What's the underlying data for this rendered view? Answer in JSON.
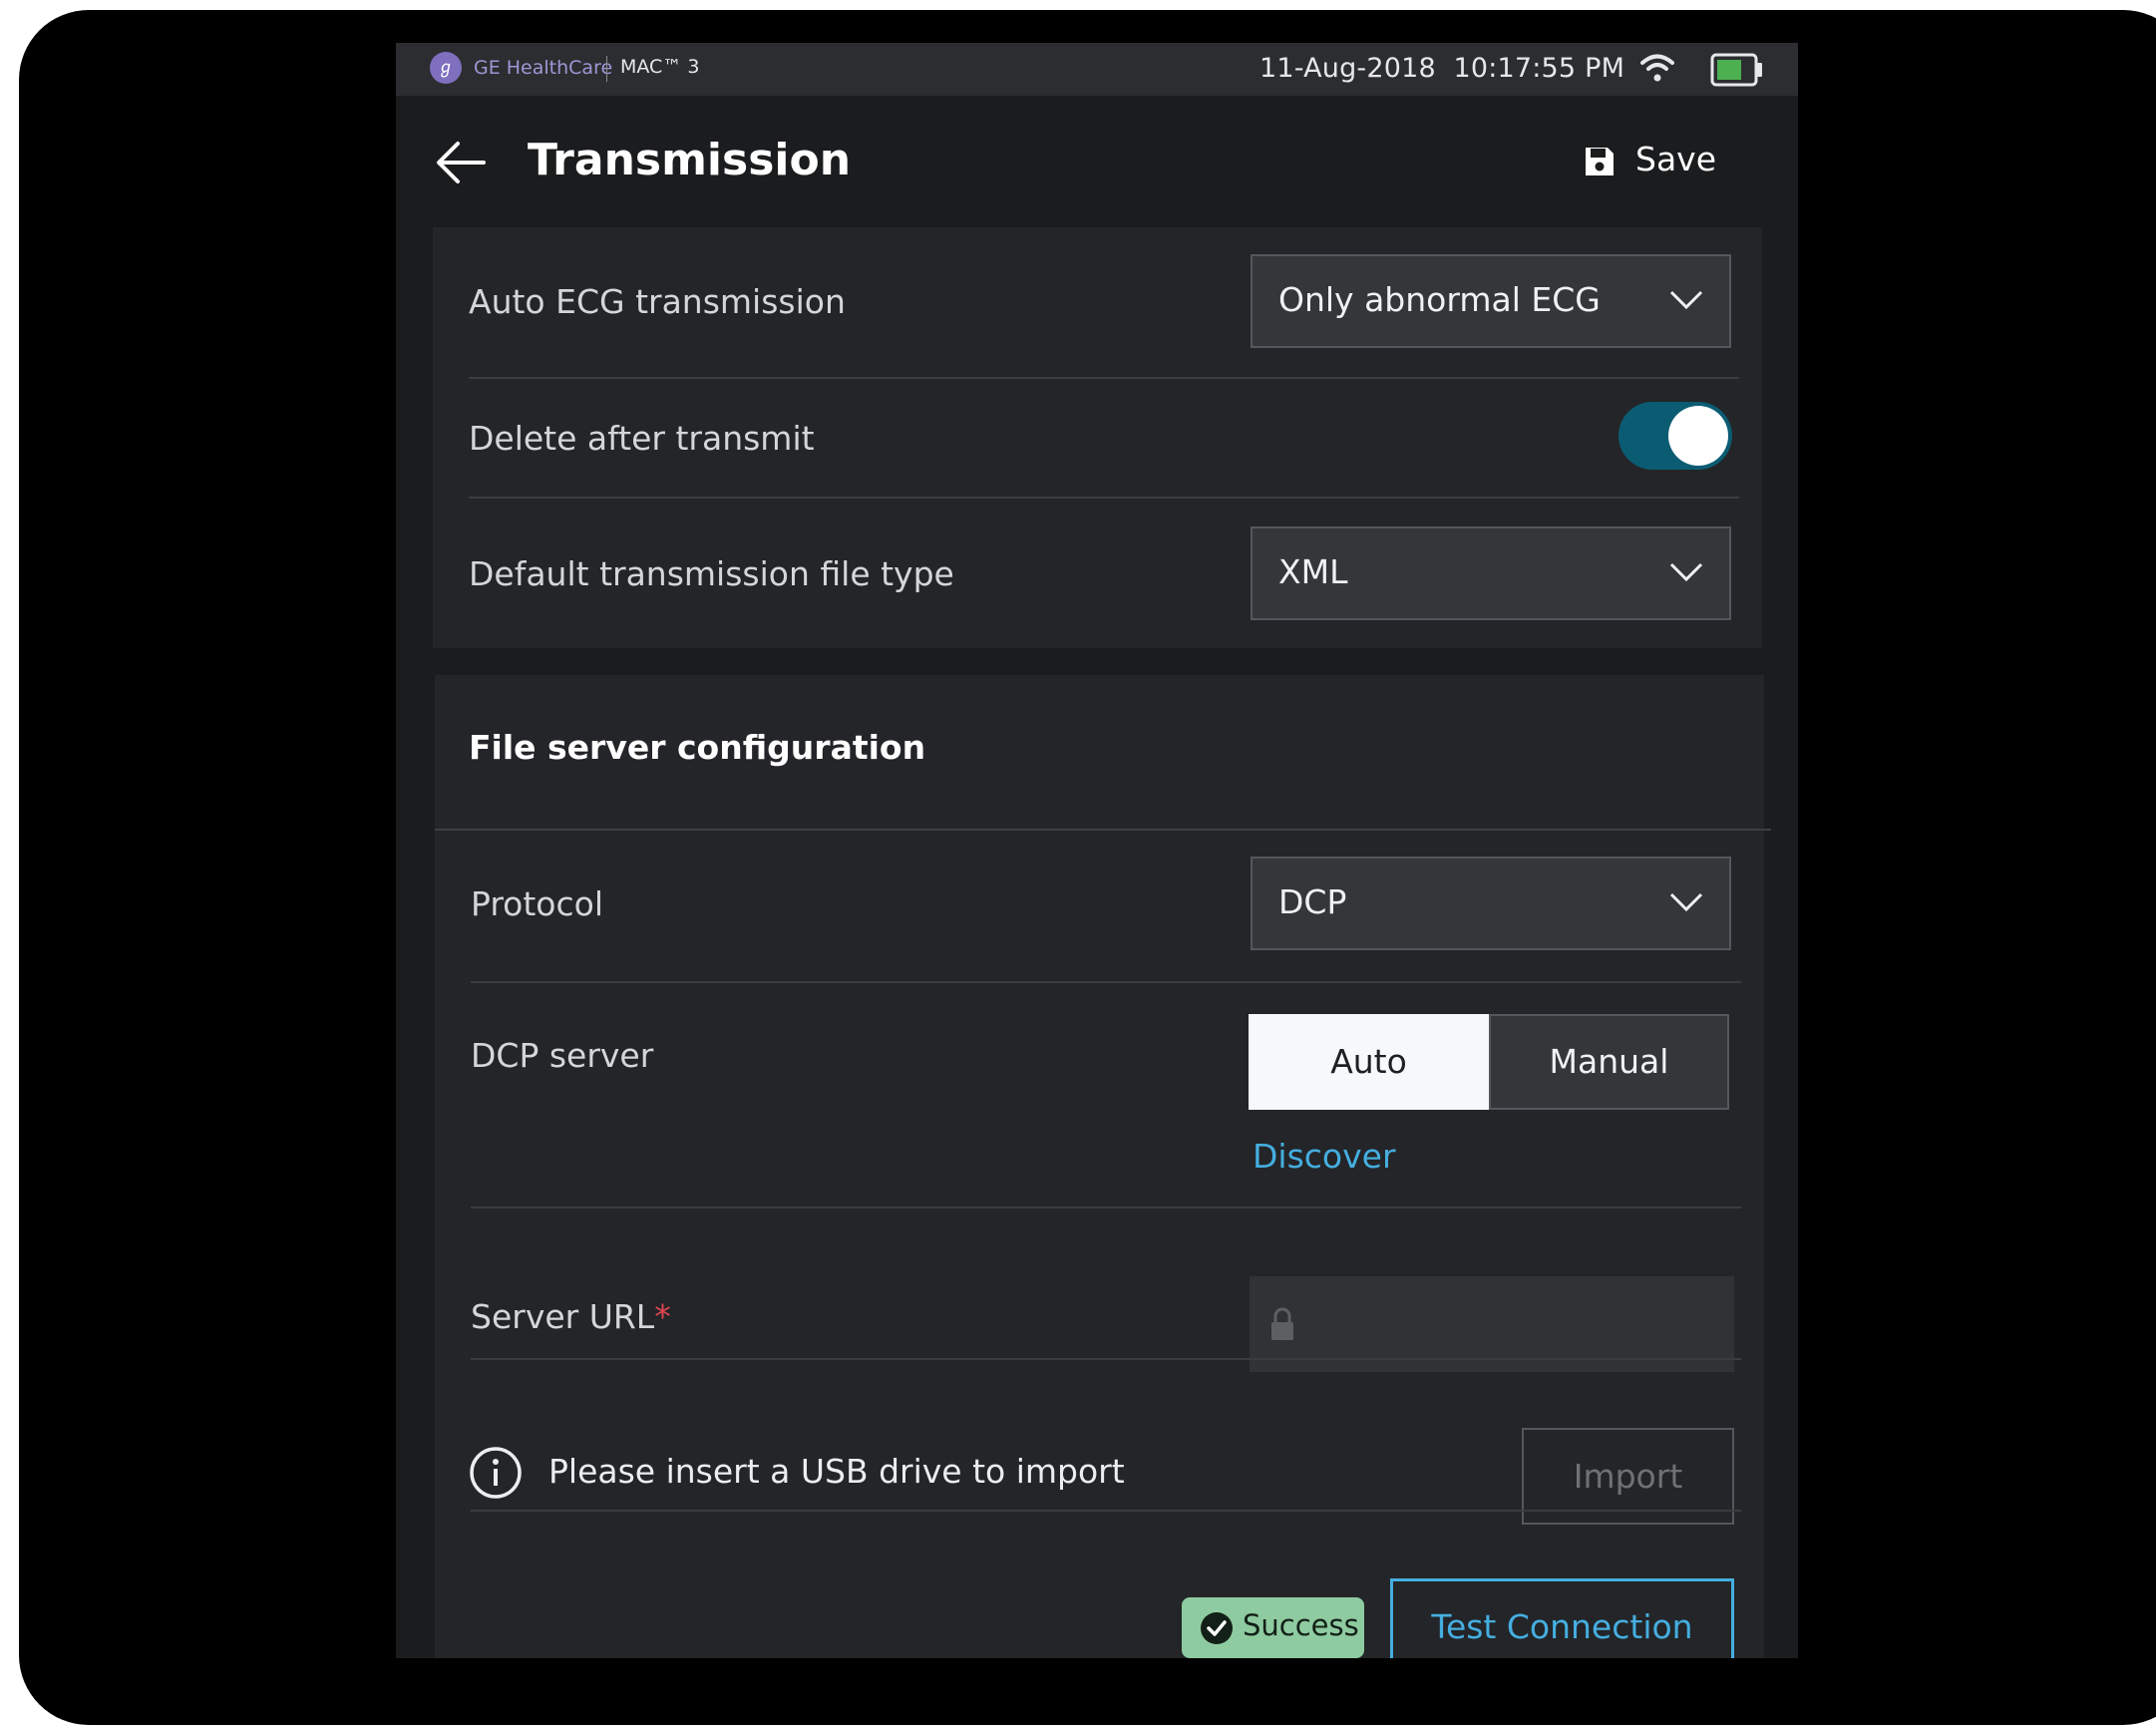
{
  "status_bar": {
    "brand": "GE HealthCare",
    "model": "MAC™ 3",
    "datetime": "11-Aug-2018  10:17:55 PM",
    "wifi_icon": "wifi-icon",
    "battery_icon": "battery-icon",
    "battery_color": "#4caf50"
  },
  "header": {
    "title": "Transmission",
    "back_icon": "arrow-left-icon",
    "save_label": "Save",
    "save_icon": "floppy-disk-icon"
  },
  "general_settings": {
    "auto_ecg": {
      "label": "Auto ECG transmission",
      "value": "Only abnormal ECG"
    },
    "delete_after": {
      "label": "Delete after transmit",
      "enabled": true
    },
    "file_type": {
      "label": "Default transmission file type",
      "value": "XML"
    }
  },
  "file_server": {
    "title": "File server configuration",
    "protocol": {
      "label": "Protocol",
      "value": "DCP"
    },
    "dcp_server": {
      "label": "DCP server",
      "options": [
        "Auto",
        "Manual"
      ],
      "selected": "Auto",
      "discover_label": "Discover"
    },
    "server_url": {
      "label": "Server URL",
      "required_mark": "*",
      "value": ""
    },
    "usb": {
      "message": "Please insert a USB drive to import",
      "import_label": "Import"
    },
    "connection": {
      "status": "Success",
      "test_label": "Test Connection"
    }
  },
  "colors": {
    "accent": "#45aee0",
    "toggle_on": "#0b5c73",
    "success_bg": "#8ecba0",
    "required": "#e0454f"
  }
}
